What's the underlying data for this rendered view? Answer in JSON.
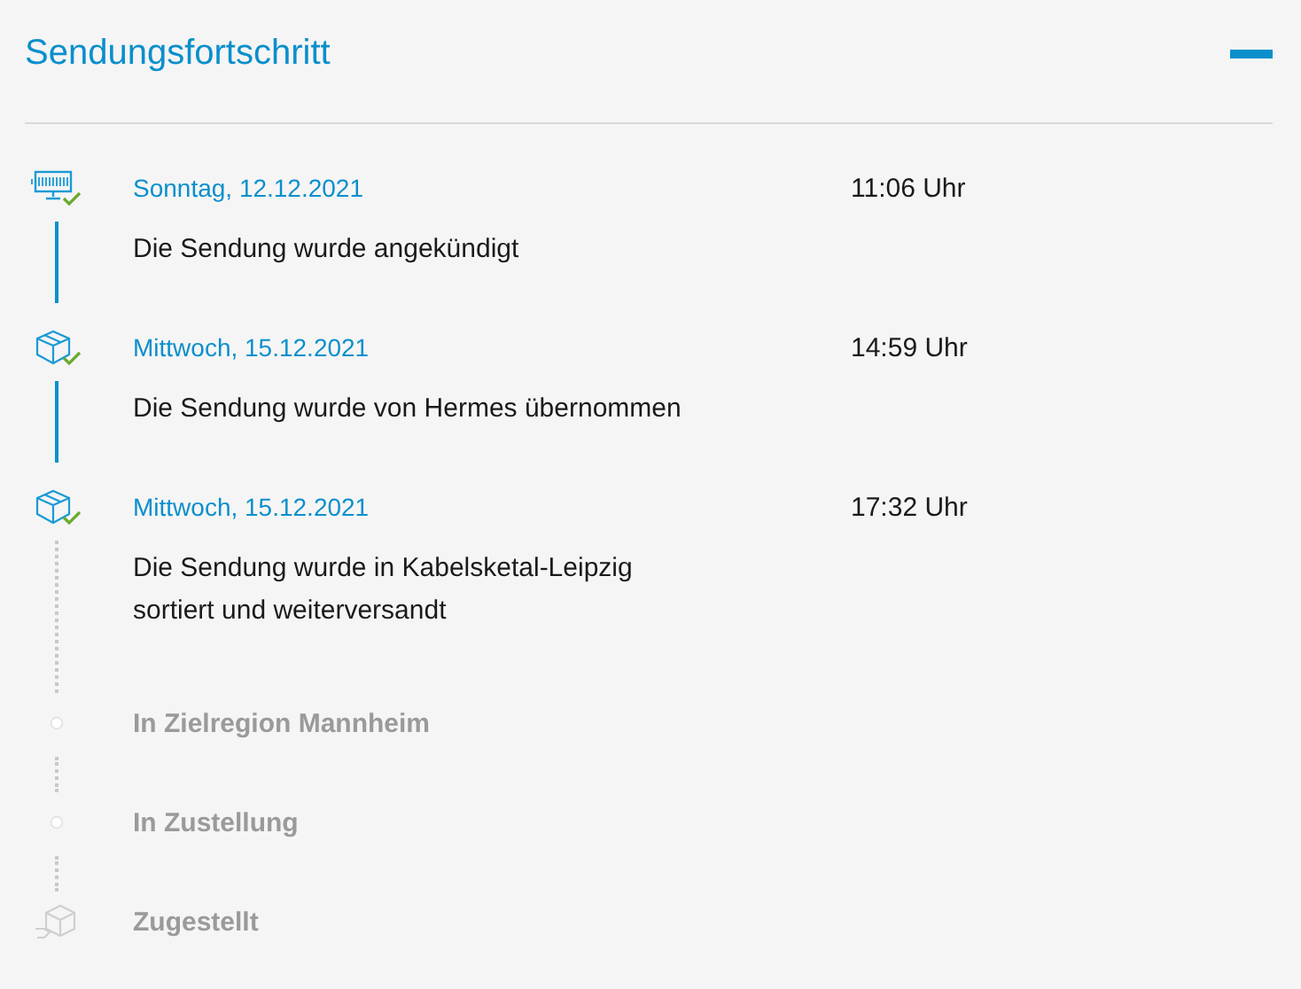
{
  "panel": {
    "title": "Sendungsfortschritt",
    "expanded": true
  },
  "events": [
    {
      "kind": "announced",
      "date": "Sonntag, 12.12.2021",
      "time": "11:06 Uhr",
      "text": "Die Sendung wurde angekündigt"
    },
    {
      "kind": "processed",
      "date": "Mittwoch, 15.12.2021",
      "time": "14:59 Uhr",
      "text": "Die Sendung wurde von Hermes übernommen"
    },
    {
      "kind": "processed",
      "date": "Mittwoch, 15.12.2021",
      "time": "17:32 Uhr",
      "text": "Die Sendung wurde in Kabelsketal-Leipzig sortiert und weiterversandt"
    },
    {
      "kind": "pending",
      "label": "In Zielregion Mannheim"
    },
    {
      "kind": "pending",
      "label": "In Zustellung"
    },
    {
      "kind": "final",
      "label": "Zugestellt"
    }
  ]
}
